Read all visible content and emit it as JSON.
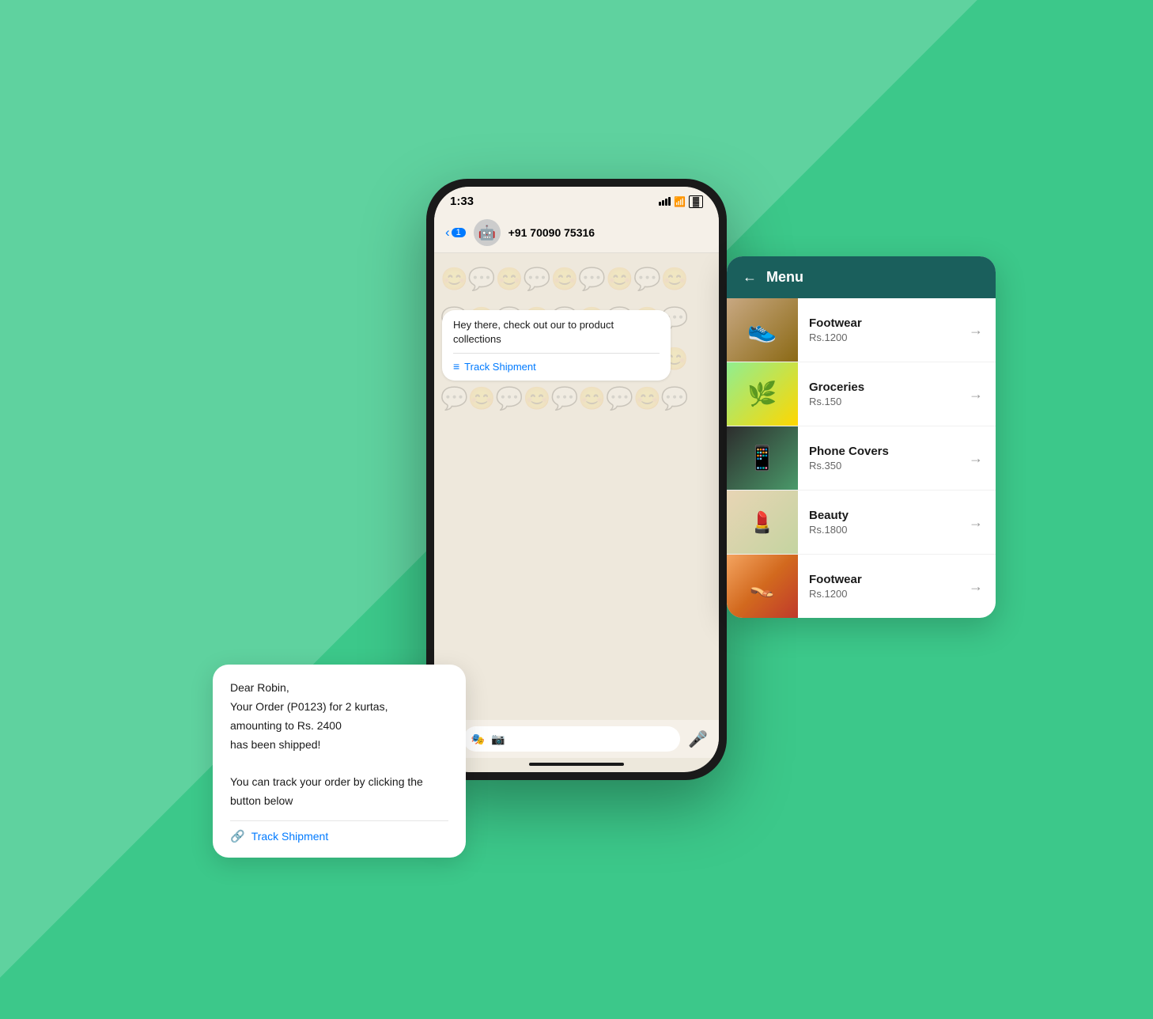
{
  "background": {
    "color": "#3CC88A"
  },
  "phone": {
    "status_bar": {
      "time": "1:33",
      "signal": "signal",
      "wifi": "wifi",
      "battery": "battery"
    },
    "header": {
      "back_label": "1",
      "contact_name": "+91 70090 75316"
    },
    "chat": {
      "bottom_bar": {
        "plus_icon": "+",
        "sticker_icon": "🎭",
        "camera_icon": "📷",
        "mic_icon": "🎤"
      }
    }
  },
  "promo_bubble": {
    "text": "Hey there, check out our\nto product collections",
    "link_label": "Track Shipment"
  },
  "order_bubble": {
    "line1": "Dear Robin,",
    "line2": "Your Order (P0123) for 2 kurtas,",
    "line3": "amounting to Rs. 2400",
    "line4": "has been shipped!",
    "line5": "",
    "line6": "You can track your order by clicking the",
    "line7": "button below",
    "link_label": "Track Shipment"
  },
  "menu": {
    "title": "Menu",
    "back_icon": "←",
    "items": [
      {
        "name": "Footwear",
        "price": "Rs.1200",
        "emoji": "👟",
        "thumb_class": "thumb-footwear"
      },
      {
        "name": "Groceries",
        "price": "Rs.150",
        "emoji": "🌿",
        "thumb_class": "thumb-groceries"
      },
      {
        "name": "Phone Covers",
        "price": "Rs.350",
        "emoji": "📱",
        "thumb_class": "thumb-phones"
      },
      {
        "name": "Beauty",
        "price": "Rs.1800",
        "emoji": "💄",
        "thumb_class": "thumb-beauty"
      },
      {
        "name": "Footwear",
        "price": "Rs.1200",
        "emoji": "👡",
        "thumb_class": "thumb-footwear2"
      }
    ]
  }
}
